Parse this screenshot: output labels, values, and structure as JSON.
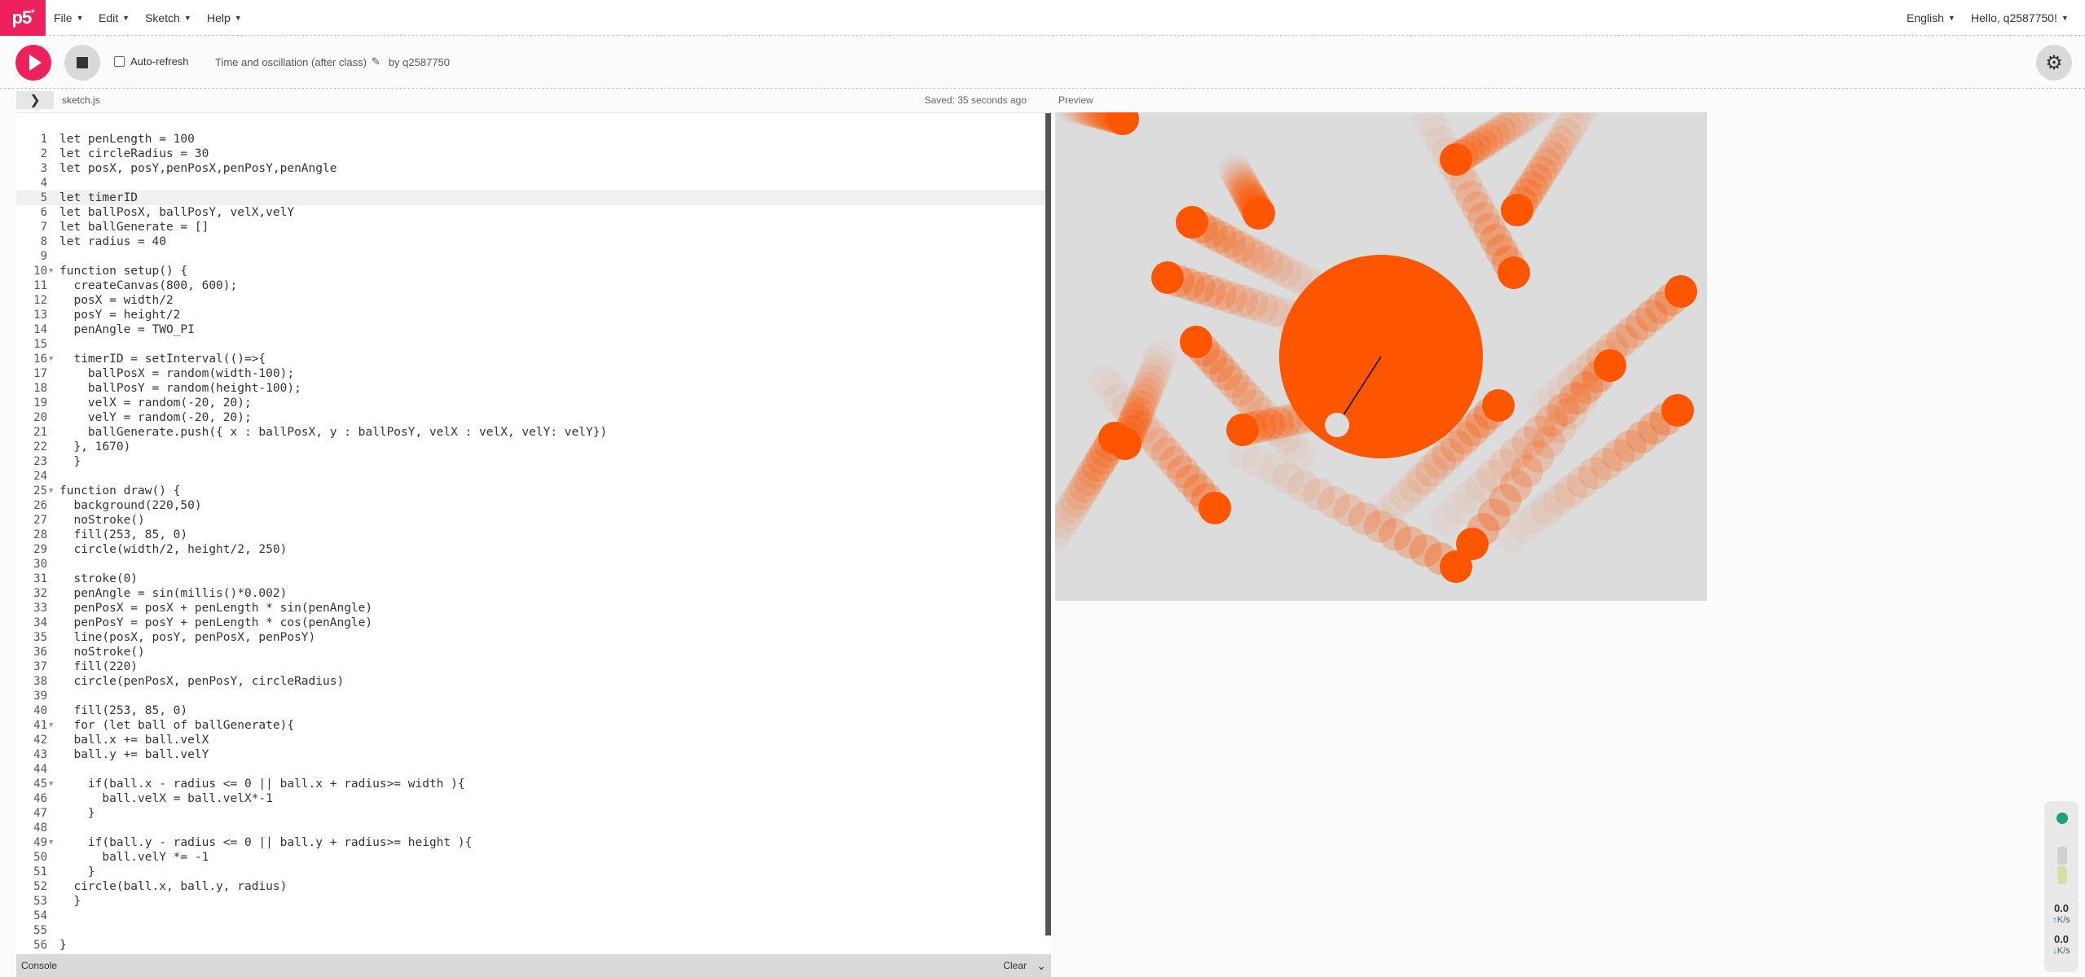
{
  "nav": {
    "logo": "p5",
    "logo_sup": "*",
    "menus": [
      {
        "label": "File"
      },
      {
        "label": "Edit"
      },
      {
        "label": "Sketch"
      },
      {
        "label": "Help"
      }
    ],
    "language": "English",
    "user": "Hello, q2587750!"
  },
  "toolbar": {
    "auto_refresh_label": "Auto-refresh",
    "sketch_title": "Time and oscillation (after class)",
    "by": "by q2587750"
  },
  "editor": {
    "file_name": "sketch.js",
    "saved": "Saved: 35 seconds ago",
    "active_line": 5,
    "lines": [
      {
        "n": "1",
        "code": "let penLength = 100"
      },
      {
        "n": "2",
        "code": "let circleRadius = 30"
      },
      {
        "n": "3",
        "code": "let posX, posY,penPosX,penPosY,penAngle"
      },
      {
        "n": "4",
        "code": ""
      },
      {
        "n": "5",
        "code": "let timerID"
      },
      {
        "n": "6",
        "code": "let ballPosX, ballPosY, velX,velY"
      },
      {
        "n": "7",
        "code": "let ballGenerate = []"
      },
      {
        "n": "8",
        "code": "let radius = 40"
      },
      {
        "n": "9",
        "code": ""
      },
      {
        "n": "10",
        "code": "function setup() {",
        "fold": true
      },
      {
        "n": "11",
        "code": "  createCanvas(800, 600);"
      },
      {
        "n": "12",
        "code": "  posX = width/2"
      },
      {
        "n": "13",
        "code": "  posY = height/2"
      },
      {
        "n": "14",
        "code": "  penAngle = TWO_PI"
      },
      {
        "n": "15",
        "code": ""
      },
      {
        "n": "16",
        "code": "  timerID = setInterval(()=>{",
        "fold": true
      },
      {
        "n": "17",
        "code": "    ballPosX = random(width-100);"
      },
      {
        "n": "18",
        "code": "    ballPosY = random(height-100);"
      },
      {
        "n": "19",
        "code": "    velX = random(-20, 20);"
      },
      {
        "n": "20",
        "code": "    velY = random(-20, 20);"
      },
      {
        "n": "21",
        "code": "    ballGenerate.push({ x : ballPosX, y : ballPosY, velX : velX, velY: velY})"
      },
      {
        "n": "22",
        "code": "  }, 1670)"
      },
      {
        "n": "23",
        "code": "  }"
      },
      {
        "n": "24",
        "code": ""
      },
      {
        "n": "25",
        "code": "function draw() {",
        "fold": true
      },
      {
        "n": "26",
        "code": "  background(220,50)"
      },
      {
        "n": "27",
        "code": "  noStroke()"
      },
      {
        "n": "28",
        "code": "  fill(253, 85, 0)"
      },
      {
        "n": "29",
        "code": "  circle(width/2, height/2, 250)"
      },
      {
        "n": "30",
        "code": ""
      },
      {
        "n": "31",
        "code": "  stroke(0)"
      },
      {
        "n": "32",
        "code": "  penAngle = sin(millis()*0.002)"
      },
      {
        "n": "33",
        "code": "  penPosX = posX + penLength * sin(penAngle)"
      },
      {
        "n": "34",
        "code": "  penPosY = posY + penLength * cos(penAngle)"
      },
      {
        "n": "35",
        "code": "  line(posX, posY, penPosX, penPosY)"
      },
      {
        "n": "36",
        "code": "  noStroke()"
      },
      {
        "n": "37",
        "code": "  fill(220)"
      },
      {
        "n": "38",
        "code": "  circle(penPosX, penPosY, circleRadius)"
      },
      {
        "n": "39",
        "code": ""
      },
      {
        "n": "40",
        "code": "  fill(253, 85, 0)"
      },
      {
        "n": "41",
        "code": "  for (let ball of ballGenerate){",
        "fold": true
      },
      {
        "n": "42",
        "code": "  ball.x += ball.velX"
      },
      {
        "n": "43",
        "code": "  ball.y += ball.velY"
      },
      {
        "n": "44",
        "code": ""
      },
      {
        "n": "45",
        "code": "    if(ball.x - radius <= 0 || ball.x + radius>= width ){",
        "fold": true
      },
      {
        "n": "46",
        "code": "      ball.velX = ball.velX*-1"
      },
      {
        "n": "47",
        "code": "    }"
      },
      {
        "n": "48",
        "code": ""
      },
      {
        "n": "49",
        "code": "    if(ball.y - radius <= 0 || ball.y + radius>= height ){",
        "fold": true
      },
      {
        "n": "50",
        "code": "      ball.velY *= -1"
      },
      {
        "n": "51",
        "code": "    }"
      },
      {
        "n": "52",
        "code": "  circle(ball.x, ball.y, radius)"
      },
      {
        "n": "53",
        "code": "  }"
      },
      {
        "n": "54",
        "code": ""
      },
      {
        "n": "55",
        "code": ""
      },
      {
        "n": "56",
        "code": "}"
      }
    ]
  },
  "preview": {
    "label": "Preview",
    "background": "#dcdcdc",
    "accent": "#fd5500",
    "pendulum_color": "#dcdcdc"
  },
  "console": {
    "label": "Console",
    "clear": "Clear"
  },
  "netwidget": {
    "up_value": "0.0",
    "up_unit": "K/s",
    "down_value": "0.0",
    "down_unit": "K/s"
  },
  "colors": {
    "brand": "#ed225d",
    "accent": "#fd5500"
  }
}
